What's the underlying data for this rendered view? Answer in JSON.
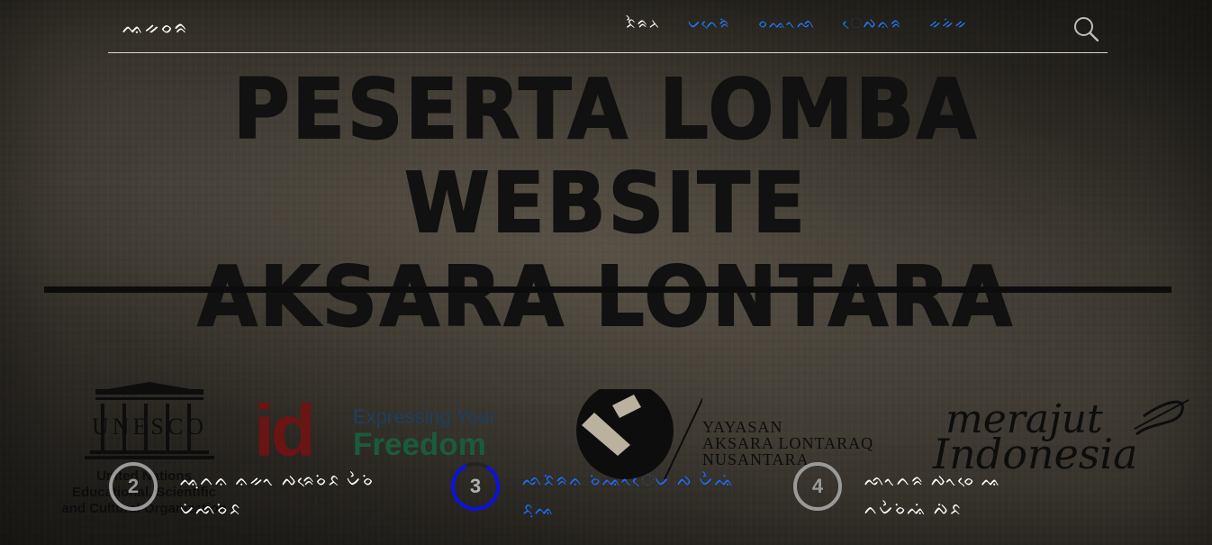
{
  "nav": {
    "brand": "ᨕᨀᨔᨑ",
    "items": [
      {
        "label": "ᨅᨛᨑᨂ",
        "color": "#ffffff"
      },
      {
        "label": "ᨆᨈᨙᨑᨗ",
        "color": "#1e7bff"
      },
      {
        "label": "ᨔᨕᨚᨒ",
        "color": "#1e7bff"
      },
      {
        "label": "ᨙᨄᨊᨑ",
        "color": "#1e7bff"
      },
      {
        "label": "ᨀᨀᨗᨀ",
        "color": "#1e7bff"
      }
    ],
    "search_icon": "search-icon"
  },
  "banner": {
    "line1": "PESERTA LOMBA WEBSITE",
    "line2": "AKSARA LONTARA"
  },
  "logos": {
    "unesco": {
      "mark": "UNESCO",
      "line1": "United Nations",
      "line2": "Educational, Scientific",
      "line3": "and Cultural Organization"
    },
    "id": {
      "letters": "id",
      "line1": "Expressing Your",
      "line2": "Freedom"
    },
    "yayasan": {
      "line1": "YAYASAN",
      "line2": "AKSARA LONTARAQ",
      "line3": "NUSANTARA"
    },
    "merajut": {
      "line1": "merajut",
      "line2": "Indonesia"
    }
  },
  "steps": [
    {
      "number": "2",
      "label": "ᨕᨘᨈᨊ ᨊᨀᨚ ᨄᨑᨙᨔᨗᨅ ᨆᨛᨔᨗ ᨆᨗᨒᨔᨗᨅ",
      "progress": 1,
      "ring_color": "#9a9a9a",
      "label_color": "#ffffff",
      "active": false
    },
    {
      "number": "3",
      "label": "ᨒᨅᨗᨑᨊ ᨔᨗᨕᨚᨙᨆ ᨄ ᨆᨛᨕᨗ ᨅᨘᨕ",
      "progress": 0.85,
      "ring_color": "#0b12e0",
      "label_color": "#1e6cff",
      "active": true
    },
    {
      "number": "4",
      "label": "ᨒᨚᨈᨑ ᨄᨚᨔᨙ ᨕ ᨈᨆᨛᨔᨗᨕᨗ ᨄᨗᨅ",
      "progress": 1,
      "ring_color": "#9a9a9a",
      "label_color": "#ffffff",
      "active": false
    }
  ]
}
